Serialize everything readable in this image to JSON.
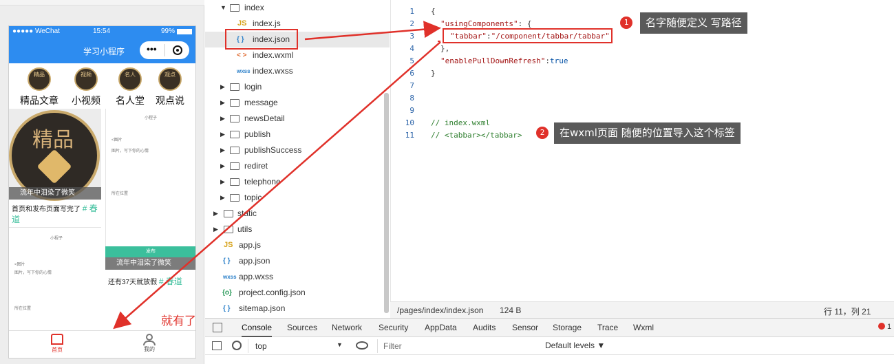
{
  "simulator": {
    "status": {
      "carrier": "●●●●● WeChat",
      "time": "15:54",
      "battery": "99%"
    },
    "nav_title": "学习小程序",
    "categories": [
      {
        "badge": "精品",
        "label": "精品文章"
      },
      {
        "badge": "视频",
        "label": "小视频"
      },
      {
        "badge": "名人",
        "label": "名人堂"
      },
      {
        "badge": "观点",
        "label": "观点说"
      }
    ],
    "big_badge_text": "精品",
    "card1": {
      "user": "流年中泪染了微笑",
      "title": "首页和发布页面写完了",
      "tag": "# 春道"
    },
    "card2": {
      "user": "流年中泪染了微笑",
      "title": "还有37天就放假",
      "tag": "# 春道"
    },
    "small_thumb": {
      "nav": "小程子",
      "line1": "<图片",
      "line2": "图片，写下你的心情",
      "line3": "所在位置"
    },
    "green_bar": "发布",
    "tabbar": [
      {
        "label": "首页"
      },
      {
        "label": "我的"
      }
    ],
    "annotation_text": "就有了"
  },
  "tree": {
    "items": [
      {
        "label": "index",
        "type": "folder-open"
      },
      {
        "label": "index.js",
        "type": "js"
      },
      {
        "label": "index.json",
        "type": "json",
        "selected": true
      },
      {
        "label": "index.wxml",
        "type": "wxml"
      },
      {
        "label": "index.wxss",
        "type": "wxss"
      },
      {
        "label": "login",
        "type": "folder"
      },
      {
        "label": "message",
        "type": "folder"
      },
      {
        "label": "newsDetail",
        "type": "folder"
      },
      {
        "label": "publish",
        "type": "folder"
      },
      {
        "label": "publishSuccess",
        "type": "folder"
      },
      {
        "label": "rediret",
        "type": "folder"
      },
      {
        "label": "telephone",
        "type": "folder"
      },
      {
        "label": "topic",
        "type": "folder"
      },
      {
        "label": "static",
        "type": "folder-root"
      },
      {
        "label": "utils",
        "type": "folder-root"
      },
      {
        "label": "app.js",
        "type": "js-root"
      },
      {
        "label": "app.json",
        "type": "json-root"
      },
      {
        "label": "app.wxss",
        "type": "wxss-root"
      },
      {
        "label": "project.config.json",
        "type": "config-root"
      },
      {
        "label": "sitemap.json",
        "type": "json-root"
      }
    ],
    "icons": {
      "js": "JS",
      "json": "{ }",
      "wxml": "< >",
      "wxss": "wxss",
      "config": "{o}"
    }
  },
  "editor": {
    "line_numbers": [
      "1",
      "2",
      "3",
      "4",
      "5",
      "6",
      "7",
      "8",
      "9",
      "10",
      "11"
    ],
    "lines": {
      "l1": "{",
      "l2_key": "\"usingComponents\"",
      "l2_rest": ": {",
      "l3_key": "\"tabbar\"",
      "l3_sep": ":",
      "l3_val": "\"/component/tabbar/tabbar\"",
      "l4": "},",
      "l5_key": "\"enablePullDownRefresh\"",
      "l5_sep": ":",
      "l5_val": "true",
      "l6": "}",
      "l10": "// index.wxml",
      "l11_pre": "// ",
      "l11_tag": "<tabbar></tabbar>"
    },
    "status": {
      "path": "/pages/index/index.json",
      "size": "124 B",
      "cursor": "行 11，列 21"
    }
  },
  "callouts": [
    {
      "num": "1",
      "text": "名字随便定义 写路径"
    },
    {
      "num": "2",
      "text": "在wxml页面  随便的位置导入这个标签"
    }
  ],
  "devtools": {
    "tabs": [
      "Console",
      "Sources",
      "Network",
      "Security",
      "AppData",
      "Audits",
      "Sensor",
      "Storage",
      "Trace",
      "Wxml"
    ],
    "active_tab": "Console",
    "context": "top",
    "filter_placeholder": "Filter",
    "levels": "Default levels ▼",
    "error_count": "1"
  },
  "colors": {
    "accent": "#2d8cf0",
    "annotation_red": "#e0312a",
    "callout_bg": "#5a5a5a",
    "green": "#3bbf9c"
  }
}
